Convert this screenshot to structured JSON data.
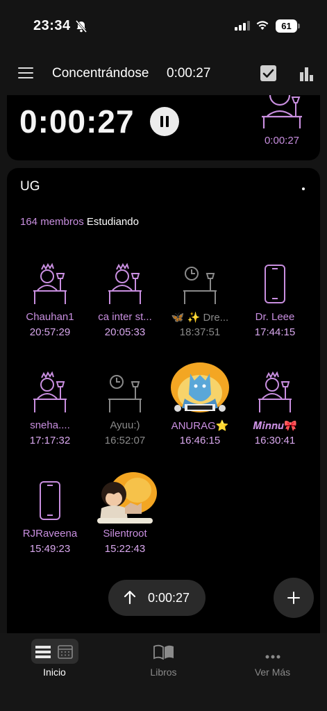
{
  "status_bar": {
    "time": "23:34",
    "battery": "61"
  },
  "app_bar": {
    "title": "Concentrándose",
    "timer": "0:00:27"
  },
  "session": {
    "timer": "0:00:27",
    "my_time": "0:00:27"
  },
  "group": {
    "name": "UG",
    "member_count": "164 membros",
    "member_status": "Estudiando",
    "members": [
      {
        "name": "Chauhan1",
        "time": "20:57:29",
        "icon": "studying-person-icon",
        "color": "purple"
      },
      {
        "name": "ca inter st...",
        "time": "20:05:33",
        "icon": "studying-person-icon",
        "color": "purple"
      },
      {
        "name": "🦋 ✨ Dre...",
        "time": "18:37:51",
        "icon": "desk-clock-icon",
        "color": "gray"
      },
      {
        "name": "Dr. Leee",
        "time": "17:44:15",
        "icon": "phone-icon",
        "color": "purple"
      },
      {
        "name": "sneha....",
        "time": "17:17:32",
        "icon": "studying-person-icon",
        "color": "purple"
      },
      {
        "name": "Ayuu:)",
        "time": "16:52:07",
        "icon": "desk-clock-icon",
        "color": "gray"
      },
      {
        "name": "ANURAG⭐",
        "time": "16:46:15",
        "icon": "avatar-image-wolf",
        "color": "purple"
      },
      {
        "name": "𝑴𝒊𝒏𝒏𝒖🎀",
        "time": "16:30:41",
        "icon": "studying-person-icon",
        "color": "purple"
      },
      {
        "name": "RJRaveena",
        "time": "15:49:23",
        "icon": "phone-icon",
        "color": "purple"
      },
      {
        "name": "Silentroot",
        "time": "15:22:43",
        "icon": "avatar-image-boy",
        "color": "purple"
      }
    ]
  },
  "floating": {
    "timer": "0:00:27"
  },
  "tabs": [
    {
      "label": "Inicio",
      "icon": "home-layout-icon",
      "active": true
    },
    {
      "label": "Libros",
      "icon": "book-icon",
      "active": false
    },
    {
      "label": "Ver Más",
      "icon": "more-dots-icon",
      "active": false
    }
  ],
  "colors": {
    "accent": "#c98fe0",
    "inactive": "#8a8a8a",
    "background": "#141414",
    "card": "#000000"
  }
}
